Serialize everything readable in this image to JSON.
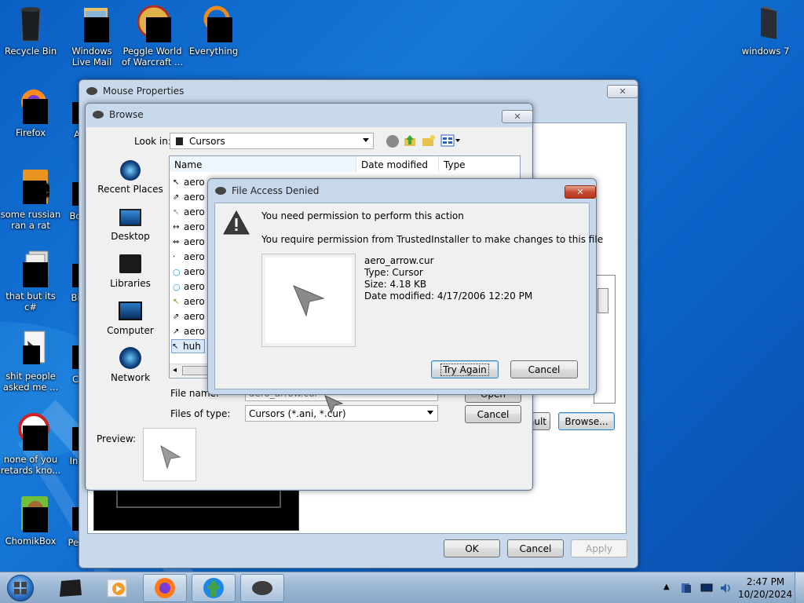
{
  "desktop": {
    "icons": [
      {
        "label": "Recycle Bin"
      },
      {
        "label": "Windows Live Mail"
      },
      {
        "label": "Peggle World of Warcraft ..."
      },
      {
        "label": "Everything"
      },
      {
        "label": "windows 7"
      },
      {
        "label": "Firefox"
      },
      {
        "label": "some russian ran a rat"
      },
      {
        "label": "that but its c#"
      },
      {
        "label": "shit people asked me ..."
      },
      {
        "label": "none of you retards kno..."
      },
      {
        "label": "ChomikBox"
      }
    ],
    "partial_labels": [
      "A",
      "Bo",
      "Bi",
      "C",
      "Ins",
      "Peg"
    ]
  },
  "mouse_properties": {
    "title": "Mouse Properties",
    "buttons": {
      "ok": "OK",
      "cancel": "Cancel",
      "apply": "Apply",
      "browse": "Browse...",
      "default_partial": "ault"
    }
  },
  "browse": {
    "title": "Browse",
    "look_in_label": "Look in:",
    "look_in_value": "Cursors",
    "places": [
      {
        "label": "Recent Places"
      },
      {
        "label": "Desktop"
      },
      {
        "label": "Libraries"
      },
      {
        "label": "Computer"
      },
      {
        "label": "Network"
      }
    ],
    "columns": {
      "name": "Name",
      "date_modified": "Date modified",
      "type": "Type"
    },
    "files": [
      "aero",
      "aero",
      "aero",
      "aero",
      "aero",
      "aero",
      "aero",
      "aero",
      "aero",
      "aero",
      "aero",
      "huh"
    ],
    "file_name_label": "File name:",
    "file_name_value": "aero_arrow.cur",
    "files_of_type_label": "Files of type:",
    "files_of_type_value": "Cursors (*.ani, *.cur)",
    "open_button": "Open",
    "cancel_button": "Cancel",
    "preview_label": "Preview:"
  },
  "dialog": {
    "title": "File Access Denied",
    "heading": "You need permission to perform this action",
    "message": "You require permission from TrustedInstaller to make changes to this file",
    "file": {
      "name": "aero_arrow.cur",
      "type": "Type: Cursor",
      "size": "Size: 4.18 KB",
      "date": "Date modified: 4/17/2006 12:20 PM"
    },
    "try_again": "Try Again",
    "cancel": "Cancel"
  },
  "taskbar": {
    "time": "2:47 PM",
    "date": "10/20/2024"
  }
}
